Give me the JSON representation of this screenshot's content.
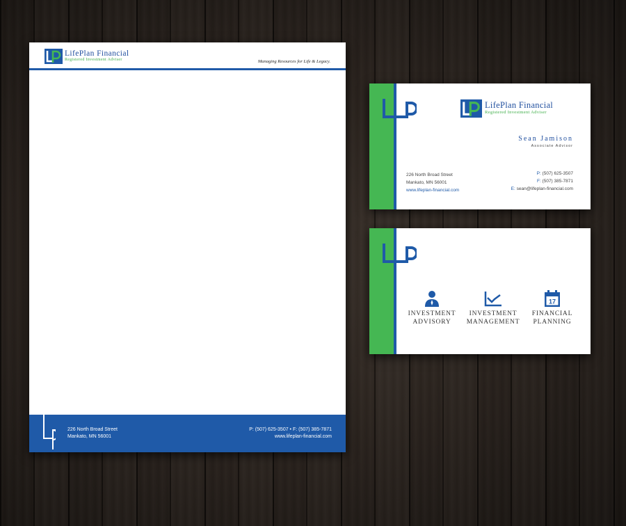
{
  "brand": {
    "name": "LifePlan Financial",
    "subtitle": "Registered Investment Adviser",
    "colors": {
      "blue": "#1f5aa8",
      "green": "#45b753"
    }
  },
  "letterhead": {
    "tagline": "Managing Resources for Life & Legacy.",
    "footer": {
      "address_line1": "226 North Broad Street",
      "address_line2": "Mankato, MN 56001",
      "phone_fax": "P: (507) 625-3507  •  F: (507) 385-7871",
      "website": "www.lifeplan-financial.com"
    }
  },
  "card_front": {
    "person_name": "Sean Jamison",
    "person_title": "Associate Advisor",
    "address_line1": "226 North Broad Street",
    "address_line2": "Mankato, MN 56001",
    "website": "www.lifeplan-financial.com",
    "phone_label": "P:",
    "phone": "(507) 625-3507",
    "fax_label": "F:",
    "fax": "(507) 385-7871",
    "email_label": "E:",
    "email": "sean@lifeplan-financial.com"
  },
  "card_back": {
    "services": [
      {
        "line1": "Investment",
        "line2": "Advisory",
        "icon": "advisor-person-icon"
      },
      {
        "line1": "Investment",
        "line2": "Management",
        "icon": "line-chart-icon"
      },
      {
        "line1": "Financial",
        "line2": "Planning",
        "icon": "calendar-icon",
        "icon_text": "17"
      }
    ]
  }
}
